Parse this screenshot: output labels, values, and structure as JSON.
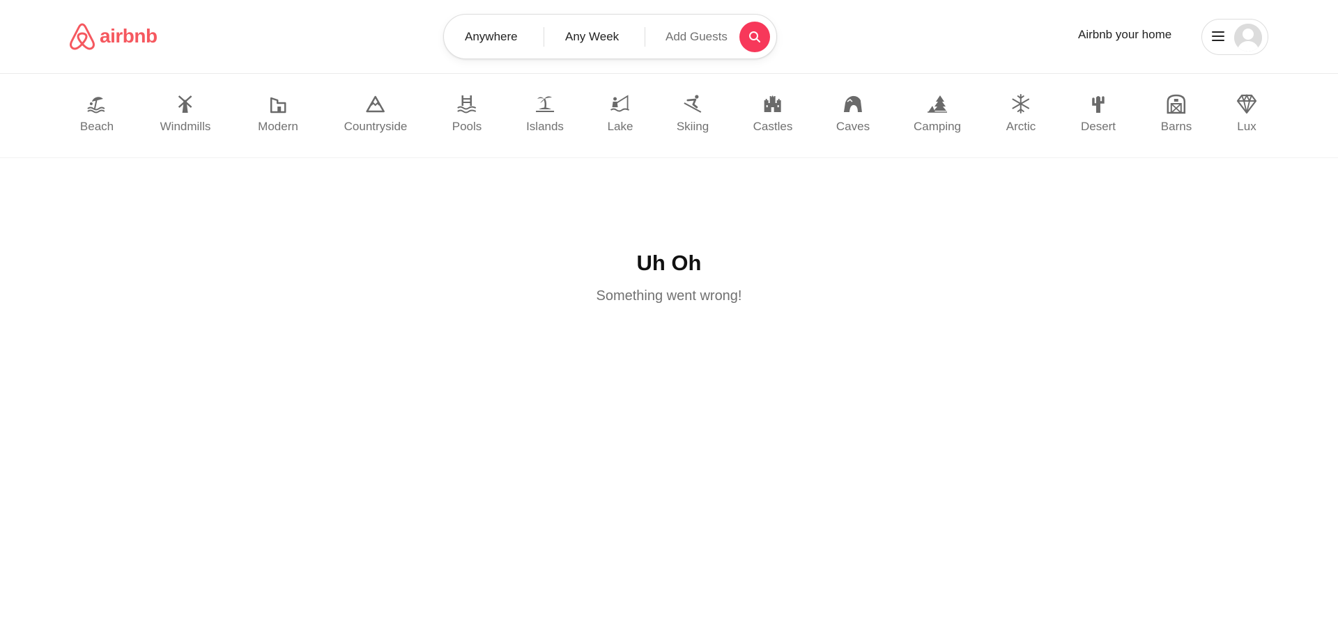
{
  "brand": {
    "name": "airbnb",
    "color": "#f5585f"
  },
  "search": {
    "location": "Anywhere",
    "dates": "Any Week",
    "guests": "Add Guests",
    "button_color": "#f7385a"
  },
  "header": {
    "host_link": "Airbnb your home"
  },
  "categories": [
    {
      "label": "Beach",
      "icon": "beach-umbrella-icon"
    },
    {
      "label": "Windmills",
      "icon": "windmill-icon"
    },
    {
      "label": "Modern",
      "icon": "modern-house-icon"
    },
    {
      "label": "Countryside",
      "icon": "mountain-icon"
    },
    {
      "label": "Pools",
      "icon": "pool-ladder-icon"
    },
    {
      "label": "Islands",
      "icon": "island-palm-icon"
    },
    {
      "label": "Lake",
      "icon": "lake-fishing-icon"
    },
    {
      "label": "Skiing",
      "icon": "skier-icon"
    },
    {
      "label": "Castles",
      "icon": "castle-icon"
    },
    {
      "label": "Caves",
      "icon": "cave-icon"
    },
    {
      "label": "Camping",
      "icon": "camping-tree-icon"
    },
    {
      "label": "Arctic",
      "icon": "snowflake-icon"
    },
    {
      "label": "Desert",
      "icon": "cactus-icon"
    },
    {
      "label": "Barns",
      "icon": "barn-icon"
    },
    {
      "label": "Lux",
      "icon": "diamond-icon"
    }
  ],
  "error": {
    "title": "Uh Oh",
    "message": "Something went wrong!"
  }
}
